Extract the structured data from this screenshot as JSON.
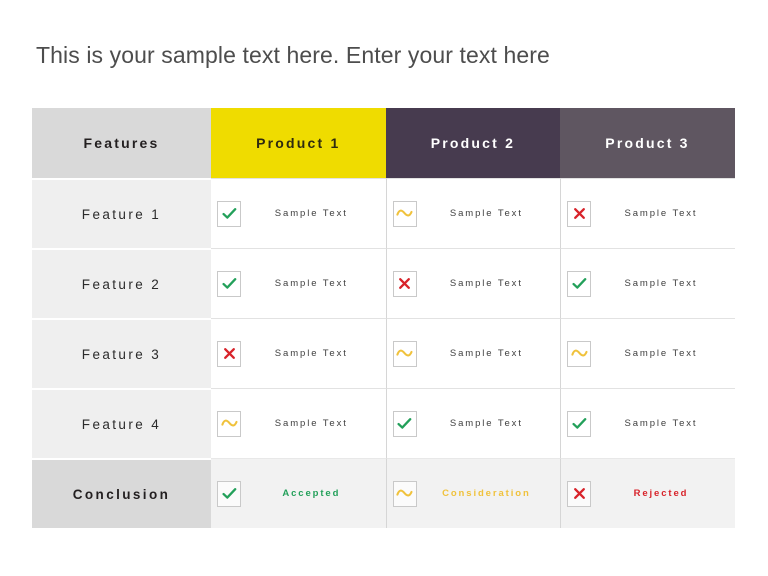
{
  "slide": {
    "title": "This is your sample text here. Enter your text here",
    "background_color": "#ffffff"
  },
  "colors": {
    "header_features_bg": "#d9d9d9",
    "header_product1_bg": "#efdc00",
    "header_product2_bg": "#473b4f",
    "header_product3_bg": "#5f5661",
    "feature_row_bg": "#efefef",
    "conclusion_row_bg": "#d9d9d9",
    "check_green": "#23a05a",
    "wave_yellow": "#f0c23c",
    "cross_red": "#d8232a"
  },
  "table": {
    "headers": [
      {
        "label": "Features"
      },
      {
        "label": "Product 1"
      },
      {
        "label": "Product 2"
      },
      {
        "label": "Product 3"
      }
    ],
    "rows": [
      {
        "feature": "Feature 1",
        "cells": [
          {
            "icon": "check-icon",
            "text": "Sample Text"
          },
          {
            "icon": "wave-icon",
            "text": "Sample Text"
          },
          {
            "icon": "cross-icon",
            "text": "Sample Text"
          }
        ]
      },
      {
        "feature": "Feature 2",
        "cells": [
          {
            "icon": "check-icon",
            "text": "Sample Text"
          },
          {
            "icon": "cross-icon",
            "text": "Sample Text"
          },
          {
            "icon": "check-icon",
            "text": "Sample Text"
          }
        ]
      },
      {
        "feature": "Feature 3",
        "cells": [
          {
            "icon": "cross-icon",
            "text": "Sample Text"
          },
          {
            "icon": "wave-icon",
            "text": "Sample Text"
          },
          {
            "icon": "wave-icon",
            "text": "Sample Text"
          }
        ]
      },
      {
        "feature": "Feature 4",
        "cells": [
          {
            "icon": "wave-icon",
            "text": "Sample Text"
          },
          {
            "icon": "check-icon",
            "text": "Sample Text"
          },
          {
            "icon": "check-icon",
            "text": "Sample Text"
          }
        ]
      },
      {
        "feature": "Conclusion",
        "cells": [
          {
            "icon": "check-icon",
            "text": "Accepted"
          },
          {
            "icon": "wave-icon",
            "text": "Consideration"
          },
          {
            "icon": "cross-icon",
            "text": "Rejected"
          }
        ]
      }
    ]
  }
}
